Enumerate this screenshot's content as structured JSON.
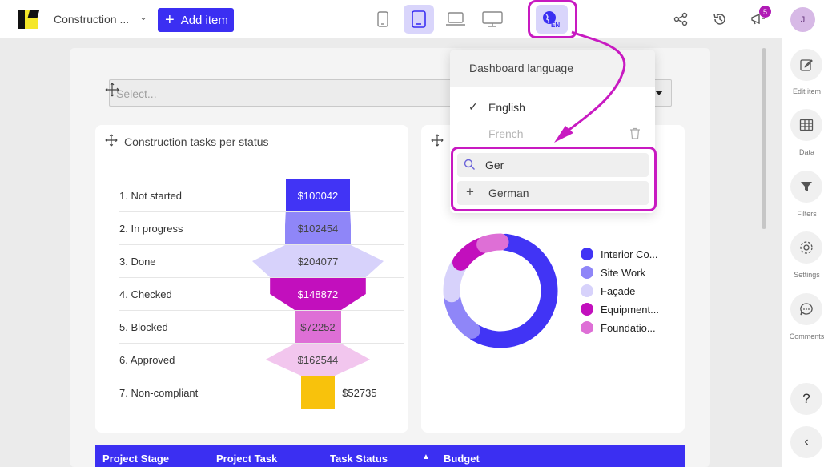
{
  "header": {
    "title": "Construction ...",
    "add_item_label": "Add item",
    "lang_badge": "EN",
    "notification_count": "5",
    "avatar_initial": "J"
  },
  "filter": {
    "placeholder": "Select..."
  },
  "funnel_card": {
    "title": "Construction tasks per status",
    "rows": [
      {
        "label": "1. Not started",
        "value": "$100042"
      },
      {
        "label": "2. In progress",
        "value": "$102454"
      },
      {
        "label": "3. Done",
        "value": "$204077"
      },
      {
        "label": "4. Checked",
        "value": "$148872"
      },
      {
        "label": "5. Blocked",
        "value": "$72252"
      },
      {
        "label": "6. Approved",
        "value": "$162544"
      },
      {
        "label": "7. Non-compliant",
        "value": "$52735"
      }
    ]
  },
  "donut_card": {
    "legend": [
      "Interior Co...",
      "Site Work",
      "Façade",
      "Equipment...",
      "Foundatio..."
    ]
  },
  "table": {
    "headers": [
      "Project Stage",
      "Project Task",
      "Task Status",
      "Budget"
    ]
  },
  "language_dropdown": {
    "title": "Dashboard language",
    "languages": [
      "English",
      "French"
    ],
    "search_value": "Ger",
    "add_option": "German"
  },
  "sidebar": {
    "items": [
      "Edit item",
      "Data",
      "Filters",
      "Settings",
      "Comments"
    ],
    "help": "?",
    "collapse": "‹"
  },
  "colors": {
    "accent": "#3b2ff2",
    "highlight": "#c81ac1",
    "series": [
      "#4134f5",
      "#8f86f8",
      "#d7d2fb",
      "#c20fbd",
      "#de6fd6",
      "#f2c6ee",
      "#f8c20c"
    ]
  },
  "chart_data": [
    {
      "type": "bar",
      "title": "Construction tasks per status",
      "categories": [
        "1. Not started",
        "2. In progress",
        "3. Done",
        "4. Checked",
        "5. Blocked",
        "6. Approved",
        "7. Non-compliant"
      ],
      "values": [
        100042,
        102454,
        204077,
        148872,
        72252,
        162544,
        52735
      ]
    },
    {
      "type": "pie",
      "categories": [
        "Interior Co...",
        "Site Work",
        "Façade",
        "Equipment...",
        "Foundatio..."
      ],
      "values": [
        55,
        12,
        9,
        8,
        5
      ]
    }
  ]
}
